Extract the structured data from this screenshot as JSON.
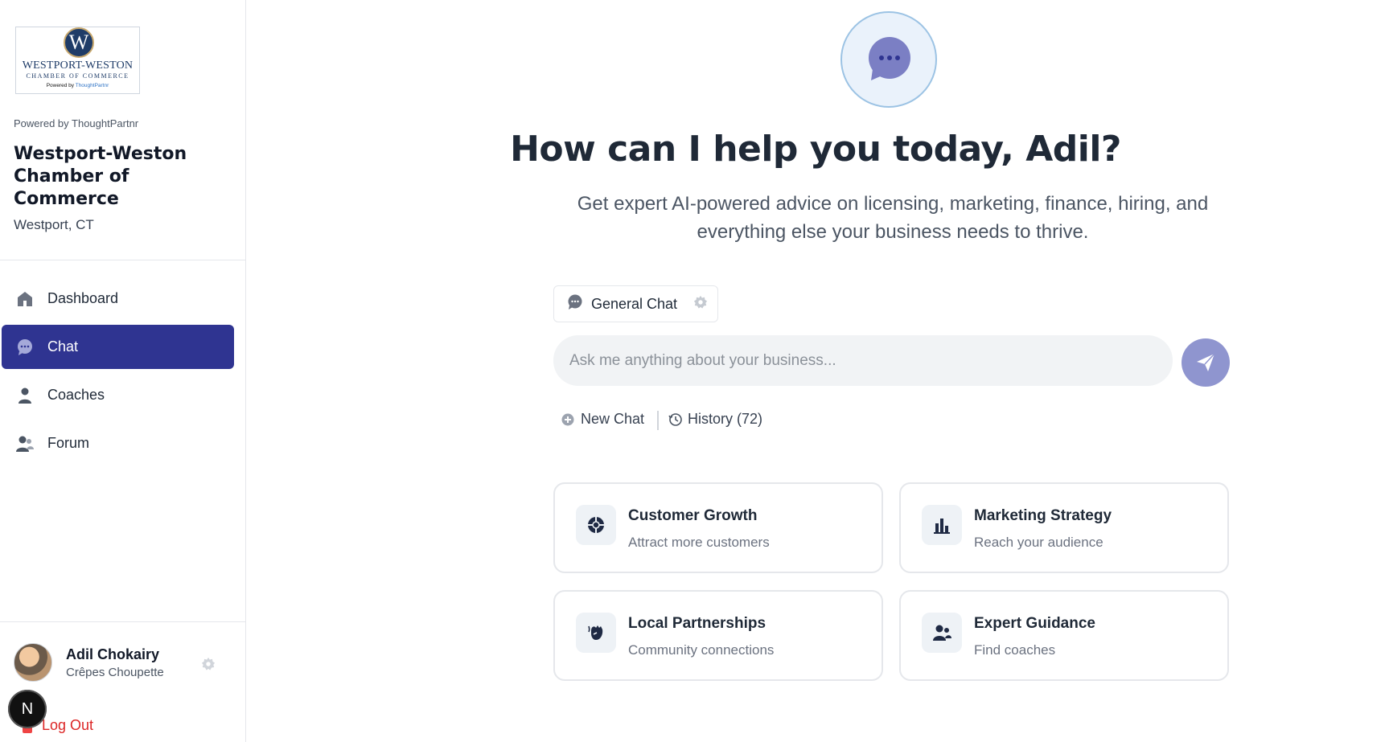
{
  "sidebar": {
    "logo": {
      "initial": "W",
      "line1": "WESTPORT-WESTON",
      "line2": "CHAMBER OF COMMERCE",
      "line3_prefix": "Powered by ",
      "line3_brand": "ThoughtPartnr"
    },
    "powered_by": "Powered by ThoughtPartnr",
    "org_name": "Westport-Weston Chamber of Commerce",
    "org_location": "Westport, CT",
    "nav": [
      {
        "label": "Dashboard",
        "icon": "home-icon",
        "active": false
      },
      {
        "label": "Chat",
        "icon": "chat-bubble-icon",
        "active": true
      },
      {
        "label": "Coaches",
        "icon": "person-icon",
        "active": false
      },
      {
        "label": "Forum",
        "icon": "people-icon",
        "active": false
      }
    ],
    "user": {
      "name": "Adil Chokairy",
      "business": "Crêpes Choupette"
    },
    "logout_label": "Log Out",
    "dev_badge": "N"
  },
  "main": {
    "headline": "How can I help you today, Adil?",
    "subhead": "Get expert AI-powered advice on licensing, marketing, finance, hiring, and everything else your business needs to thrive.",
    "mode_chip": "General Chat",
    "input_placeholder": "Ask me anything about your business...",
    "new_chat_label": "New Chat",
    "history_label": "History (72)",
    "cards": [
      {
        "title": "Customer Growth",
        "subtitle": "Attract more customers",
        "icon": "target-icon"
      },
      {
        "title": "Marketing Strategy",
        "subtitle": "Reach your audience",
        "icon": "bar-chart-icon"
      },
      {
        "title": "Local Partnerships",
        "subtitle": "Community connections",
        "icon": "handshake-icon"
      },
      {
        "title": "Expert Guidance",
        "subtitle": "Find coaches",
        "icon": "users-icon"
      }
    ]
  },
  "colors": {
    "accent": "#2f3491",
    "send_button": "#8f95cf",
    "logout": "#dc2626",
    "text_dark": "#1f2937"
  }
}
